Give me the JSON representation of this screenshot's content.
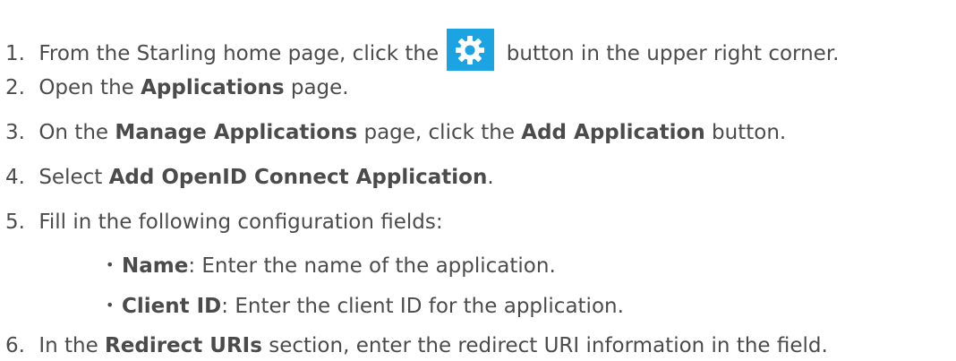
{
  "steps": [
    {
      "num": "1.",
      "pre": "From the Starling home page, click the ",
      "icon": "gear-icon",
      "post": " button in the upper right corner."
    },
    {
      "num": "2.",
      "pre": "Open the ",
      "bold": "Applications",
      "post": " page."
    },
    {
      "num": "3.",
      "pre": "On the ",
      "bold": "Manage Applications",
      "mid": " page, click the ",
      "bold2": "Add Application",
      "post": " button."
    },
    {
      "num": "4.",
      "pre": "Select ",
      "bold": "Add OpenID Connect Application",
      "post": "."
    },
    {
      "num": "5.",
      "pre": "Fill in the following configuration fields:"
    },
    {
      "num": "6.",
      "pre": "In the ",
      "bold": "Redirect URIs",
      "post": " section, enter the redirect URI information in the field."
    }
  ],
  "subitems": [
    {
      "bullet": "•",
      "bold": "Name",
      "text": ": Enter the name of the application."
    },
    {
      "bullet": "•",
      "bold": "Client ID",
      "text": ": Enter the client ID for the application."
    }
  ],
  "colors": {
    "text": "#4b4b4b",
    "gear_button": "#1ca3e2"
  }
}
